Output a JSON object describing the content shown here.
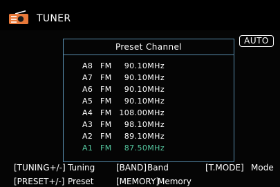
{
  "header": {
    "title": "TUNER",
    "icon": "radio-icon"
  },
  "mode_badge": "AUTO",
  "popup": {
    "title": "Preset Channel",
    "presets": [
      {
        "id": "A8",
        "band": "FM",
        "freq": "90.10MHz",
        "selected": false
      },
      {
        "id": "A7",
        "band": "FM",
        "freq": "90.10MHz",
        "selected": false
      },
      {
        "id": "A6",
        "band": "FM",
        "freq": "90.10MHz",
        "selected": false
      },
      {
        "id": "A5",
        "band": "FM",
        "freq": "90.10MHz",
        "selected": false
      },
      {
        "id": "A4",
        "band": "FM",
        "freq": "108.00MHz",
        "selected": false
      },
      {
        "id": "A3",
        "band": "FM",
        "freq": "98.10MHz",
        "selected": false
      },
      {
        "id": "A2",
        "band": "FM",
        "freq": "89.10MHz",
        "selected": false
      },
      {
        "id": "A1",
        "band": "FM",
        "freq": "87.50MHz",
        "selected": true
      }
    ],
    "selected_color": "#55c8a0"
  },
  "footer": {
    "row1": [
      {
        "key": "[TUNING+/-]",
        "label": "Tuning"
      },
      {
        "key": "[BAND]",
        "label": "Band"
      },
      {
        "key": "[T.MODE]",
        "label": "Mode"
      }
    ],
    "row2": [
      {
        "key": "[PRESET+/-]",
        "label": "Preset"
      },
      {
        "key": "[MEMORY]",
        "label": "Memory"
      }
    ]
  }
}
